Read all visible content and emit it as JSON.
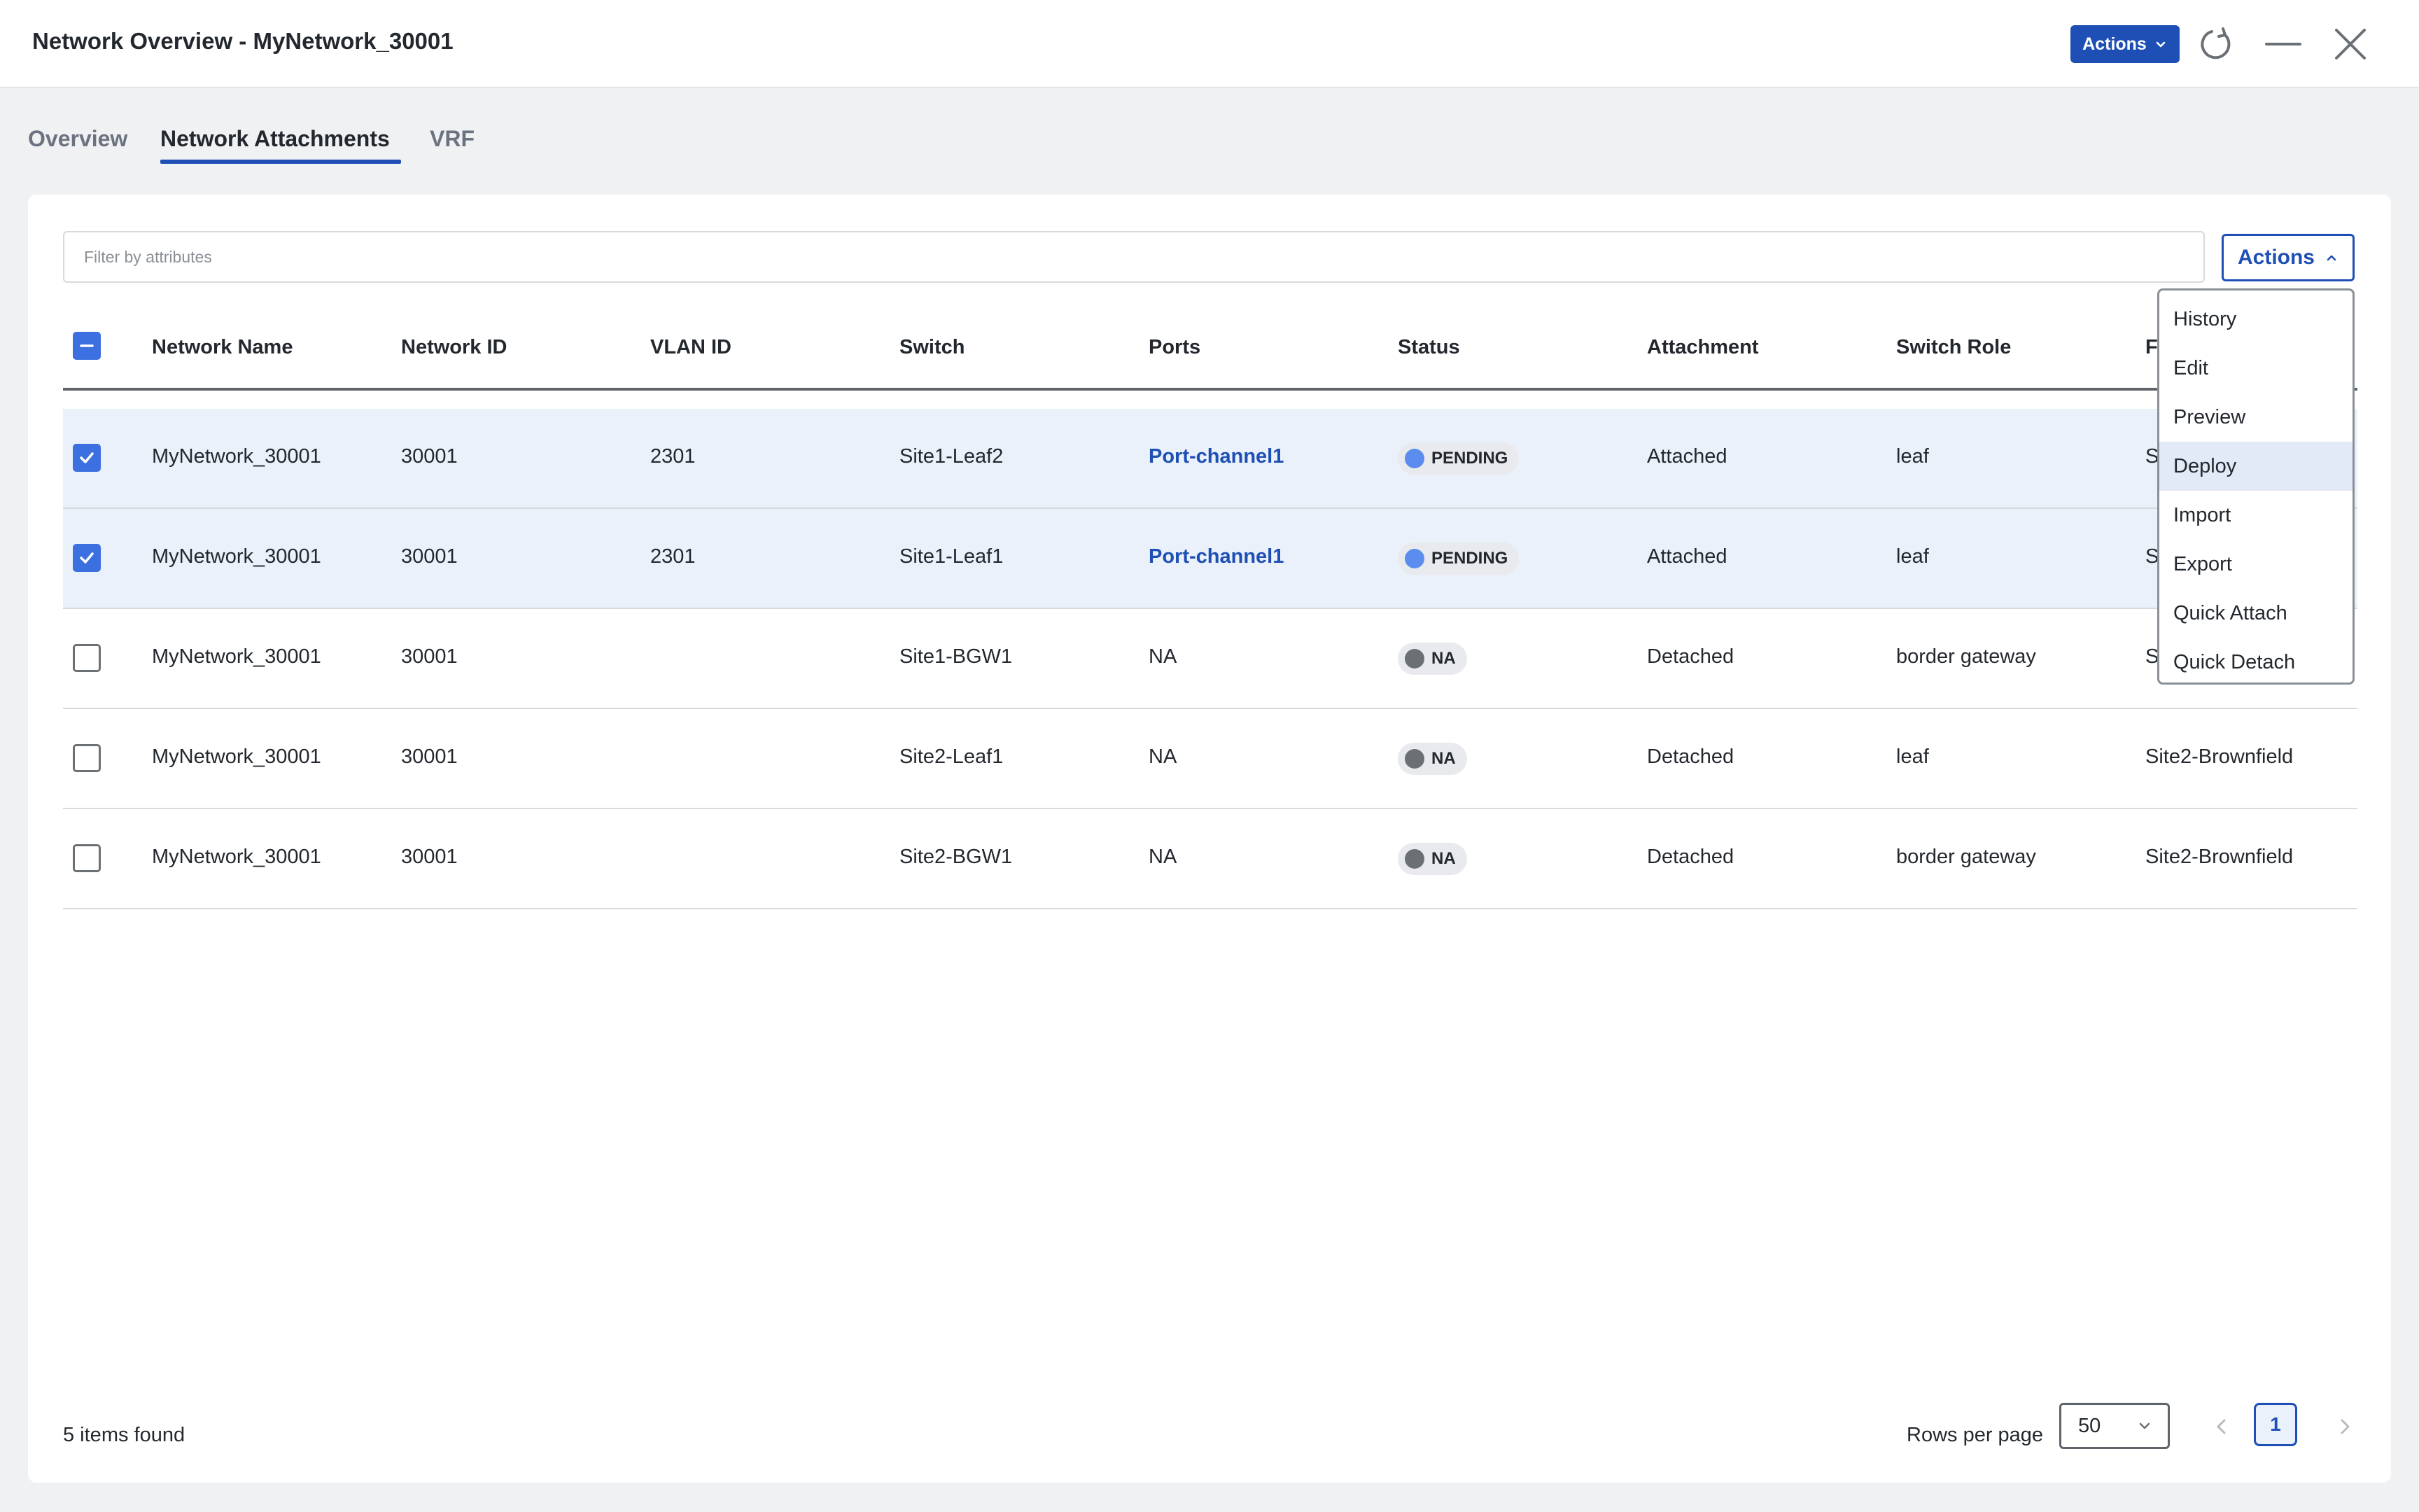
{
  "window": {
    "title": "Network Overview - MyNetwork_30001",
    "actions_label": "Actions"
  },
  "tabs": [
    {
      "label": "Overview",
      "active": false
    },
    {
      "label": "Network Attachments",
      "active": true
    },
    {
      "label": "VRF",
      "active": false
    }
  ],
  "filter": {
    "placeholder": "Filter by attributes",
    "value": ""
  },
  "actions_button": {
    "label": "Actions",
    "expanded": true
  },
  "table": {
    "columns": [
      "Network Name",
      "Network ID",
      "VLAN ID",
      "Switch",
      "Ports",
      "Status",
      "Attachment",
      "Switch Role",
      "Fabric"
    ],
    "rows": [
      {
        "selected": true,
        "network_name": "MyNetwork_30001",
        "network_id": "30001",
        "vlan_id": "2301",
        "switch": "Site1-Leaf2",
        "ports": "Port-channel1",
        "status": "PENDING",
        "attachment": "Attached",
        "switch_role": "leaf",
        "fabric": "Site1"
      },
      {
        "selected": true,
        "network_name": "MyNetwork_30001",
        "network_id": "30001",
        "vlan_id": "2301",
        "switch": "Site1-Leaf1",
        "ports": "Port-channel1",
        "status": "PENDING",
        "attachment": "Attached",
        "switch_role": "leaf",
        "fabric": "Site1"
      },
      {
        "selected": false,
        "network_name": "MyNetwork_30001",
        "network_id": "30001",
        "vlan_id": "",
        "switch": "Site1-BGW1",
        "ports": "NA",
        "status": "NA",
        "attachment": "Detached",
        "switch_role": "border gateway",
        "fabric": "Site1"
      },
      {
        "selected": false,
        "network_name": "MyNetwork_30001",
        "network_id": "30001",
        "vlan_id": "",
        "switch": "Site2-Leaf1",
        "ports": "NA",
        "status": "NA",
        "attachment": "Detached",
        "switch_role": "leaf",
        "fabric": "Site2-Brownfield"
      },
      {
        "selected": false,
        "network_name": "MyNetwork_30001",
        "network_id": "30001",
        "vlan_id": "",
        "switch": "Site2-BGW1",
        "ports": "NA",
        "status": "NA",
        "attachment": "Detached",
        "switch_role": "border gateway",
        "fabric": "Site2-Brownfield"
      }
    ]
  },
  "actions_menu": {
    "items": [
      "History",
      "Edit",
      "Preview",
      "Deploy",
      "Import",
      "Export",
      "Quick Attach",
      "Quick Detach"
    ],
    "highlighted": "Deploy"
  },
  "footer": {
    "items_found": "5 items found",
    "rows_per_page_label": "Rows per page",
    "rows_per_page_value": "50",
    "current_page": "1"
  },
  "colors": {
    "accent": "#1e4fb5",
    "checkbox": "#3c6fe0",
    "pending_dot": "#5b8def",
    "na_dot": "#6b7075",
    "selected_row": "#eaf1fb",
    "menu_highlight": "#e2e9f7"
  }
}
